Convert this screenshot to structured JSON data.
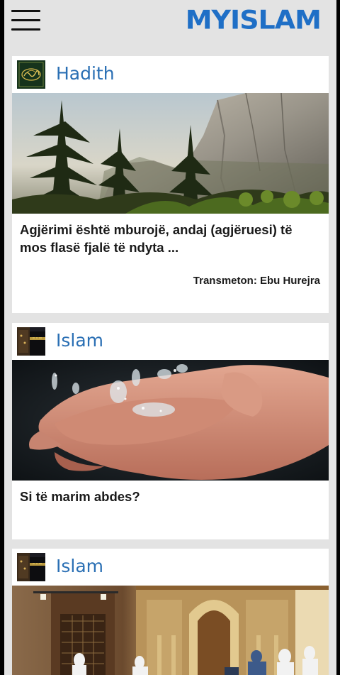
{
  "header": {
    "menu_icon": "hamburger-menu-icon",
    "logo_text": "MYISLAM",
    "brand_color": "#1f6fc6"
  },
  "cards": [
    {
      "category": "Hadith",
      "thumbnail_icon": "calligraphy-thumbnail",
      "image": "forest-cliff-photo",
      "title": "Agjërimi është mburojë, andaj (agjëruesi) të mos flasë fjalë të ndyta  ...",
      "attribution": "Transmeton: Ebu Hurejra"
    },
    {
      "category": "Islam",
      "thumbnail_icon": "kaaba-thumbnail",
      "image": "water-hands-photo",
      "title": "Si të marim abdes?"
    },
    {
      "category": "Islam",
      "thumbnail_icon": "kaaba-thumbnail",
      "image": "mosque-interior-photo"
    }
  ],
  "colors": {
    "category_text": "#2a6fb4",
    "background": "#e3e3e3"
  }
}
